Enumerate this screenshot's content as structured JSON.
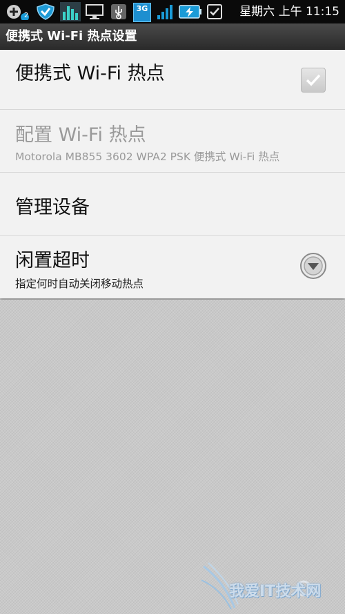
{
  "status_bar": {
    "badge_count": "2",
    "network_label": "3G",
    "clock": "星期六 上午 11:15",
    "icons": [
      "add-icon",
      "shield-icon",
      "equalizer-icon",
      "monitor-icon",
      "usb-icon",
      "3g-icon",
      "signal-icon",
      "battery-charging-icon",
      "checkbox-notification-icon"
    ]
  },
  "titlebar": {
    "title": "便携式 Wi-Fi 热点设置"
  },
  "settings": {
    "items": [
      {
        "title": "便携式 Wi-Fi 热点",
        "summary": "",
        "widget": "checkbox",
        "checked": true,
        "enabled": false
      },
      {
        "title": "配置 Wi-Fi 热点",
        "summary": "Motorola MB855 3602 WPA2 PSK 便携式 Wi-Fi 热点",
        "widget": "",
        "enabled": false
      },
      {
        "title": "管理设备",
        "summary": "",
        "widget": "",
        "enabled": true
      },
      {
        "title": "闲置超时",
        "summary": "指定何时自动关闭移动热点",
        "widget": "dropdown",
        "enabled": true
      }
    ]
  },
  "watermark": {
    "text": "我爱IT技术网"
  },
  "colors": {
    "statusbar": "#0a0a0a",
    "titlebar": "#3a3a3a",
    "list_bg": "#f2f2f2",
    "page_bg": "#c8c8c8",
    "accent": "#1a9bd7"
  }
}
